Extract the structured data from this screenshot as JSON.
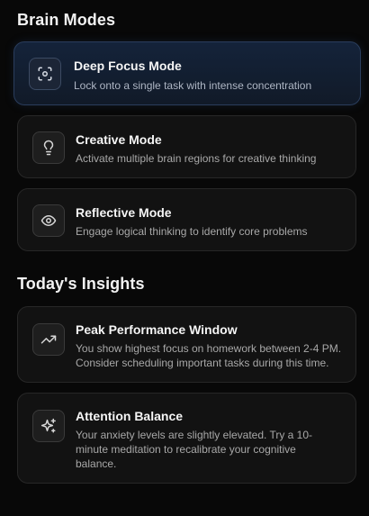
{
  "brain_modes": {
    "title": "Brain Modes",
    "items": [
      {
        "title": "Deep Focus Mode",
        "description": "Lock onto a single task with intense concentration",
        "icon": "focus-scan-icon",
        "active": true
      },
      {
        "title": "Creative Mode",
        "description": "Activate multiple brain regions for creative thinking",
        "icon": "lightbulb-icon",
        "active": false
      },
      {
        "title": "Reflective Mode",
        "description": "Engage logical thinking to identify core problems",
        "icon": "eye-icon",
        "active": false
      }
    ]
  },
  "insights": {
    "title": "Today's Insights",
    "items": [
      {
        "title": "Peak Performance Window",
        "description_lines": [
          "You show highest focus on homework between 2-4 PM.",
          "Consider scheduling important tasks during this time."
        ],
        "icon": "trending-up-icon"
      },
      {
        "title": "Attention Balance",
        "description_lines": [
          "Your anxiety levels are slightly elevated. Try a 10-",
          "minute meditation to recalibrate your cognitive",
          "balance."
        ],
        "icon": "sparkles-icon"
      }
    ]
  },
  "colors": {
    "background": "#080808",
    "card": "#121212",
    "active_card": "#14233a",
    "active_border": "#2a3d5c"
  }
}
